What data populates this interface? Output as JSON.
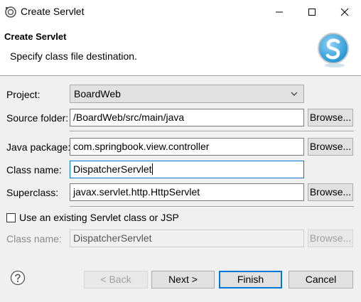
{
  "window": {
    "title": "Create Servlet"
  },
  "header": {
    "title": "Create Servlet",
    "description": "Specify class file destination."
  },
  "form": {
    "project_label": "Project:",
    "project_value": "BoardWeb",
    "source_folder_label": "Source folder:",
    "source_folder_value": "/BoardWeb/src/main/java",
    "java_package_label": "Java package:",
    "java_package_value": "com.springbook.view.controller",
    "class_name_label": "Class name:",
    "class_name_value": "DispatcherServlet",
    "superclass_label": "Superclass:",
    "superclass_value": "javax.servlet.http.HttpServlet",
    "browse_label": "Browse...",
    "existing_checkbox_label": "Use an existing Servlet class or JSP",
    "existing_checked": false,
    "existing_class_name_label": "Class name:",
    "existing_class_name_value": "DispatcherServlet"
  },
  "footer": {
    "back_label": "< Back",
    "next_label": "Next >",
    "finish_label": "Finish",
    "cancel_label": "Cancel"
  },
  "colors": {
    "accent": "#0078d7",
    "logo_blue": "#29a3e0",
    "dialog_bg": "#f0f0f0"
  },
  "icons": [
    "eclipse-app-icon",
    "minimize-icon",
    "maximize-icon",
    "close-icon",
    "servlet-logo-icon",
    "chevron-down-icon",
    "help-icon"
  ]
}
